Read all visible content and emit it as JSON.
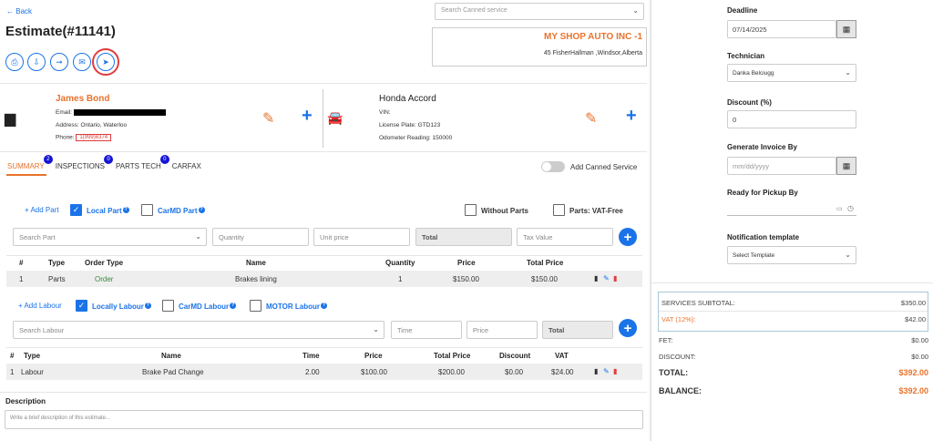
{
  "nav": {
    "back_label": "Back"
  },
  "page": {
    "title": "Estimate(#11141)"
  },
  "toolbar": {
    "icons": [
      "print-icon",
      "export-icon",
      "arrow-right-icon",
      "email-icon",
      "send-icon"
    ]
  },
  "canned": {
    "placeholder": "Search Canned service"
  },
  "shop": {
    "name": "MY SHOP AUTO INC -1",
    "address": "45 FisherHallman ,Windsor,Alberta"
  },
  "customer": {
    "name": "James Bond",
    "email_label": "Email:",
    "address_label": "Address:",
    "address_value": "Ontario, Waterloo",
    "phone_label": "Phone:",
    "phone_value": "1(999)6374"
  },
  "vehicle": {
    "name": "Honda Accord",
    "vin_label": "VIN:",
    "plate_label": "License Plate:",
    "plate_value": "GTD123",
    "odometer_label": "Odometer Reading:",
    "odometer_value": "150000"
  },
  "tabs": [
    {
      "label": "SUMMARY",
      "badge": "2"
    },
    {
      "label": "INSPECTIONS",
      "badge": "0"
    },
    {
      "label": "PARTS TECH",
      "badge": "0"
    },
    {
      "label": "CARFAX",
      "badge": ""
    }
  ],
  "add_canned_label": "Add Canned Service",
  "parts": {
    "add_label": "+ Add Part",
    "local_label": "Local Part",
    "carmd_label": "CarMD Part",
    "without_label": "Without Parts",
    "vatfree_label": "Parts: VAT-Free",
    "search_placeholder": "Search Part",
    "qty_placeholder": "Quantity",
    "unit_placeholder": "Unit price",
    "total_label": "Total",
    "tax_placeholder": "Tax Value",
    "headers": [
      "#",
      "Type",
      "Order Type",
      "Name",
      "Quantity",
      "Price",
      "Total Price"
    ],
    "rows": [
      {
        "num": "1",
        "type": "Parts",
        "order_type": "Order",
        "name": "Brakes lining",
        "qty": "1",
        "price": "$150.00",
        "total": "$150.00"
      }
    ]
  },
  "labour": {
    "add_label": "+ Add Labour",
    "local_label": "Locally Labour",
    "carmd_label": "CarMD Labour",
    "motor_label": "MOTOR Labour",
    "search_placeholder": "Search Labour",
    "time_placeholder": "Time",
    "price_placeholder": "Price",
    "total_label": "Total",
    "headers": [
      "#",
      "Type",
      "Name",
      "Time",
      "Price",
      "Total Price",
      "Discount",
      "VAT"
    ],
    "rows": [
      {
        "num": "1",
        "type": "Labour",
        "name": "Brake Pad Change",
        "time": "2.00",
        "price": "$100.00",
        "total": "$200.00",
        "discount": "$0.00",
        "vat": "$24.00"
      }
    ]
  },
  "description": {
    "label": "Description",
    "placeholder": "Write a brief description of this estimate..."
  },
  "sidebar": {
    "deadline_label": "Deadline",
    "deadline_value": "07/14/2025",
    "technician_label": "Technician",
    "technician_value": "Danka  Belciugg",
    "discount_label": "Discount (%)",
    "discount_value": "0",
    "invoice_label": "Generate Invoice By",
    "invoice_placeholder": "mm/dd/yyyy",
    "pickup_label": "Ready for Pickup By",
    "notif_label": "Notification template",
    "notif_value": "Select Template"
  },
  "totals": {
    "services_label": "SERVICES SUBTOTAL:",
    "services_value": "$350.00",
    "vat_label": "VAT (12%):",
    "vat_value": "$42.00",
    "fet_label": "FET:",
    "fet_value": "$0.00",
    "discount_label": "DISCOUNT:",
    "discount_value": "$0.00",
    "total_label": "TOTAL:",
    "total_value": "$392.00",
    "balance_label": "BALANCE:",
    "balance_value": "$392.00"
  },
  "colors": {
    "accent": "#1a73e8",
    "orange": "#e8732c",
    "danger": "#e03c3c"
  }
}
